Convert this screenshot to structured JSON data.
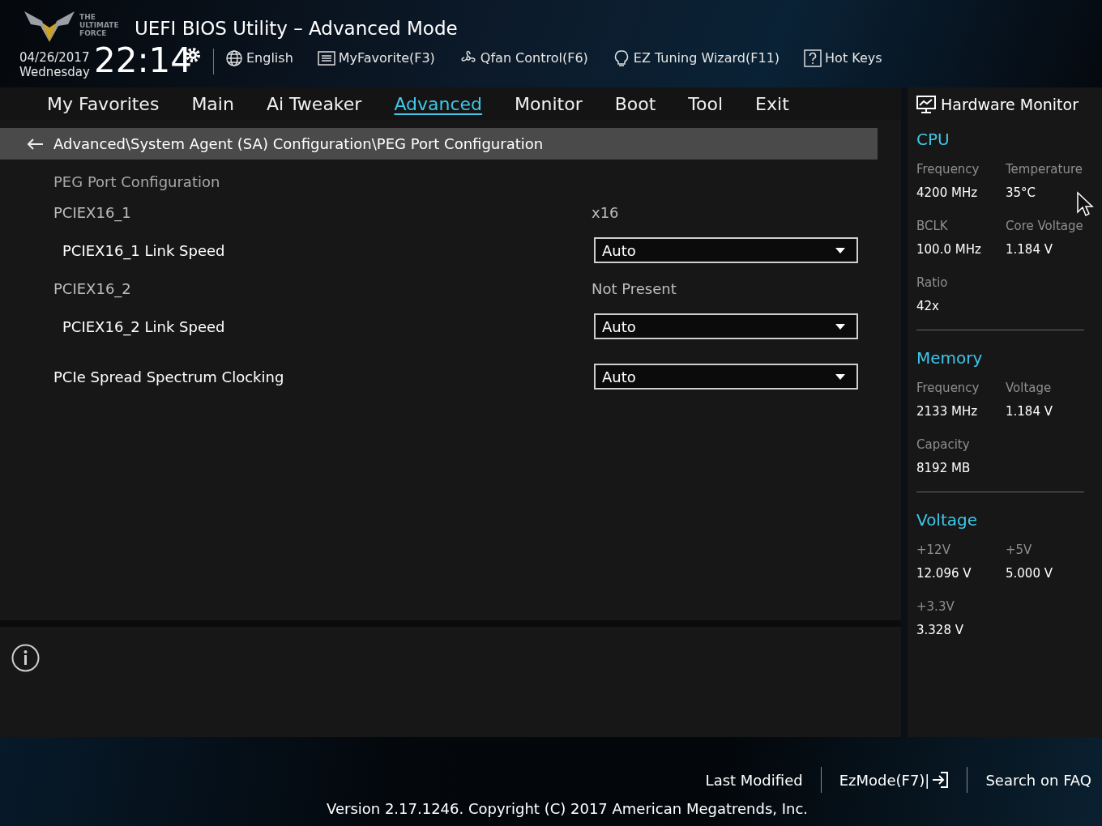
{
  "header": {
    "logo_text": [
      "THE",
      "ULTIMATE",
      "FORCE"
    ],
    "title": "UEFI BIOS Utility – Advanced Mode",
    "date": "04/26/2017",
    "weekday": "Wednesday",
    "time": "22:14",
    "tools": [
      {
        "kind": "globe",
        "label": "English"
      },
      {
        "kind": "list",
        "label": "MyFavorite(F3)"
      },
      {
        "kind": "fan",
        "label": "Qfan Control(F6)"
      },
      {
        "kind": "bulb",
        "label": "EZ Tuning Wizard(F11)"
      },
      {
        "kind": "help",
        "label": "Hot Keys"
      }
    ]
  },
  "tabs": [
    {
      "label": "My Favorites",
      "selected": false
    },
    {
      "label": "Main",
      "selected": false
    },
    {
      "label": "Ai Tweaker",
      "selected": false
    },
    {
      "label": "Advanced",
      "selected": true
    },
    {
      "label": "Monitor",
      "selected": false
    },
    {
      "label": "Boot",
      "selected": false
    },
    {
      "label": "Tool",
      "selected": false
    },
    {
      "label": "Exit",
      "selected": false
    }
  ],
  "breadcrumb": "Advanced\\System Agent (SA) Configuration\\PEG Port Configuration",
  "settings": [
    {
      "kind": "heading",
      "label": "PEG Port Configuration"
    },
    {
      "kind": "info",
      "label": "PCIEX16_1",
      "value": "x16"
    },
    {
      "kind": "select",
      "label": "PCIEX16_1 Link Speed",
      "value": "Auto"
    },
    {
      "kind": "info",
      "label": "PCIEX16_2",
      "value": "Not Present"
    },
    {
      "kind": "select",
      "label": "PCIEX16_2 Link Speed",
      "value": "Auto"
    },
    {
      "kind": "select",
      "label": "PCIe Spread Spectrum Clocking",
      "value": "Auto",
      "spaced": true
    }
  ],
  "hardware_monitor": {
    "title": "Hardware Monitor",
    "sections": [
      {
        "title": "CPU",
        "items": [
          {
            "label": "Frequency",
            "value": "4200 MHz"
          },
          {
            "label": "Temperature",
            "value": "35°C"
          },
          {
            "label": "BCLK",
            "value": "100.0 MHz"
          },
          {
            "label": "Core Voltage",
            "value": "1.184 V"
          },
          {
            "label": "Ratio",
            "value": "42x"
          }
        ]
      },
      {
        "title": "Memory",
        "items": [
          {
            "label": "Frequency",
            "value": "2133 MHz"
          },
          {
            "label": "Voltage",
            "value": "1.184 V"
          },
          {
            "label": "Capacity",
            "value": "8192 MB"
          }
        ]
      },
      {
        "title": "Voltage",
        "items": [
          {
            "label": "+12V",
            "value": "12.096 V"
          },
          {
            "label": "+5V",
            "value": "5.000 V"
          },
          {
            "label": "+3.3V",
            "value": "3.328 V"
          }
        ]
      }
    ]
  },
  "footer": {
    "links": [
      "Last Modified",
      "EzMode(F7)|",
      "Search on FAQ"
    ],
    "version": "Version 2.17.1246. Copyright (C) 2017 American Megatrends, Inc."
  }
}
